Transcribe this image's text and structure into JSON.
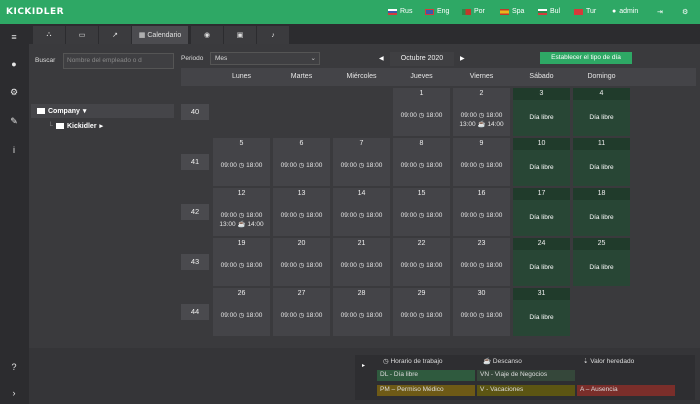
{
  "app": {
    "name": "KICKIDLER"
  },
  "header": {
    "languages": [
      {
        "label": "Rus",
        "flag": "#d23c3c"
      },
      {
        "label": "Eng",
        "flag": "#3c5aa8"
      },
      {
        "label": "Por",
        "flag": "#c0392b"
      },
      {
        "label": "Spa",
        "flag": "#e8b71c"
      },
      {
        "label": "Bul",
        "flag": "#2a8a49"
      },
      {
        "label": "Tur",
        "flag": "#d63a3a"
      }
    ],
    "user": "admin"
  },
  "tabs": {
    "calendar_label": "Calendario"
  },
  "search": {
    "label": "Buscar",
    "placeholder": "Nombre del empleado o d"
  },
  "tree": {
    "root": "Company",
    "child": "Kickidler"
  },
  "period": {
    "label": "Periodo",
    "value": "Mes"
  },
  "month": {
    "label": "Octubre 2020"
  },
  "daytype_button": "Establecer el tipo de día",
  "weekdays": [
    "Lunes",
    "Martes",
    "Miércoles",
    "Jueves",
    "Viernes",
    "Sábado",
    "Domingo"
  ],
  "weeks": [
    {
      "num": "40",
      "days": [
        null,
        null,
        null,
        {
          "date": "1",
          "l1": "09:00 ◷ 18:00",
          "l2": ""
        },
        {
          "date": "2",
          "l1": "09:00 ◷ 18:00",
          "l2": "13:00 ☕ 14:00"
        },
        {
          "date": "3",
          "free": "Día libre"
        },
        {
          "date": "4",
          "free": "Día libre"
        }
      ]
    },
    {
      "num": "41",
      "days": [
        {
          "date": "5",
          "l1": "09:00 ◷ 18:00",
          "l2": ""
        },
        {
          "date": "6",
          "l1": "09:00 ◷ 18:00",
          "l2": ""
        },
        {
          "date": "7",
          "l1": "09:00 ◷ 18:00",
          "l2": ""
        },
        {
          "date": "8",
          "l1": "09:00 ◷ 18:00",
          "l2": ""
        },
        {
          "date": "9",
          "l1": "09:00 ◷ 18:00",
          "l2": ""
        },
        {
          "date": "10",
          "free": "Día libre"
        },
        {
          "date": "11",
          "free": "Día libre"
        }
      ]
    },
    {
      "num": "42",
      "days": [
        {
          "date": "12",
          "l1": "09:00 ◷ 18:00",
          "l2": "13:00 ☕ 14:00"
        },
        {
          "date": "13",
          "l1": "09:00 ◷ 18:00",
          "l2": ""
        },
        {
          "date": "14",
          "l1": "09:00 ◷ 18:00",
          "l2": ""
        },
        {
          "date": "15",
          "l1": "09:00 ◷ 18:00",
          "l2": ""
        },
        {
          "date": "16",
          "l1": "09:00 ◷ 18:00",
          "l2": ""
        },
        {
          "date": "17",
          "free": "Día libre"
        },
        {
          "date": "18",
          "free": "Día libre"
        }
      ]
    },
    {
      "num": "43",
      "days": [
        {
          "date": "19",
          "l1": "09:00 ◷ 18:00",
          "l2": ""
        },
        {
          "date": "20",
          "l1": "09:00 ◷ 18:00",
          "l2": ""
        },
        {
          "date": "21",
          "l1": "09:00 ◷ 18:00",
          "l2": ""
        },
        {
          "date": "22",
          "l1": "09:00 ◷ 18:00",
          "l2": ""
        },
        {
          "date": "23",
          "l1": "09:00 ◷ 18:00",
          "l2": ""
        },
        {
          "date": "24",
          "free": "Día libre"
        },
        {
          "date": "25",
          "free": "Día libre"
        }
      ]
    },
    {
      "num": "44",
      "days": [
        {
          "date": "26",
          "l1": "09:00 ◷ 18:00",
          "l2": ""
        },
        {
          "date": "27",
          "l1": "09:00 ◷ 18:00",
          "l2": ""
        },
        {
          "date": "28",
          "l1": "09:00 ◷ 18:00",
          "l2": ""
        },
        {
          "date": "29",
          "l1": "09:00 ◷ 18:00",
          "l2": ""
        },
        {
          "date": "30",
          "l1": "09:00 ◷ 18:00",
          "l2": ""
        },
        {
          "date": "31",
          "free": "Día libre"
        },
        null
      ]
    }
  ],
  "legend": {
    "work_hours": "◷ Horario de trabajo",
    "break": "☕ Descanso",
    "inherited": "⇣ Valor heredado",
    "dl": "DL - Día libre",
    "vn": "VN - Viaje de Negocios",
    "pm": "PM – Permiso Médico",
    "v": "V - Vacaciones",
    "a": "A – Ausencia",
    "colors": {
      "dl": "#2f5a3e",
      "vn": "#35473a",
      "pm": "#6e5a16",
      "v": "#5c5513",
      "a": "#7a2e2a"
    }
  }
}
